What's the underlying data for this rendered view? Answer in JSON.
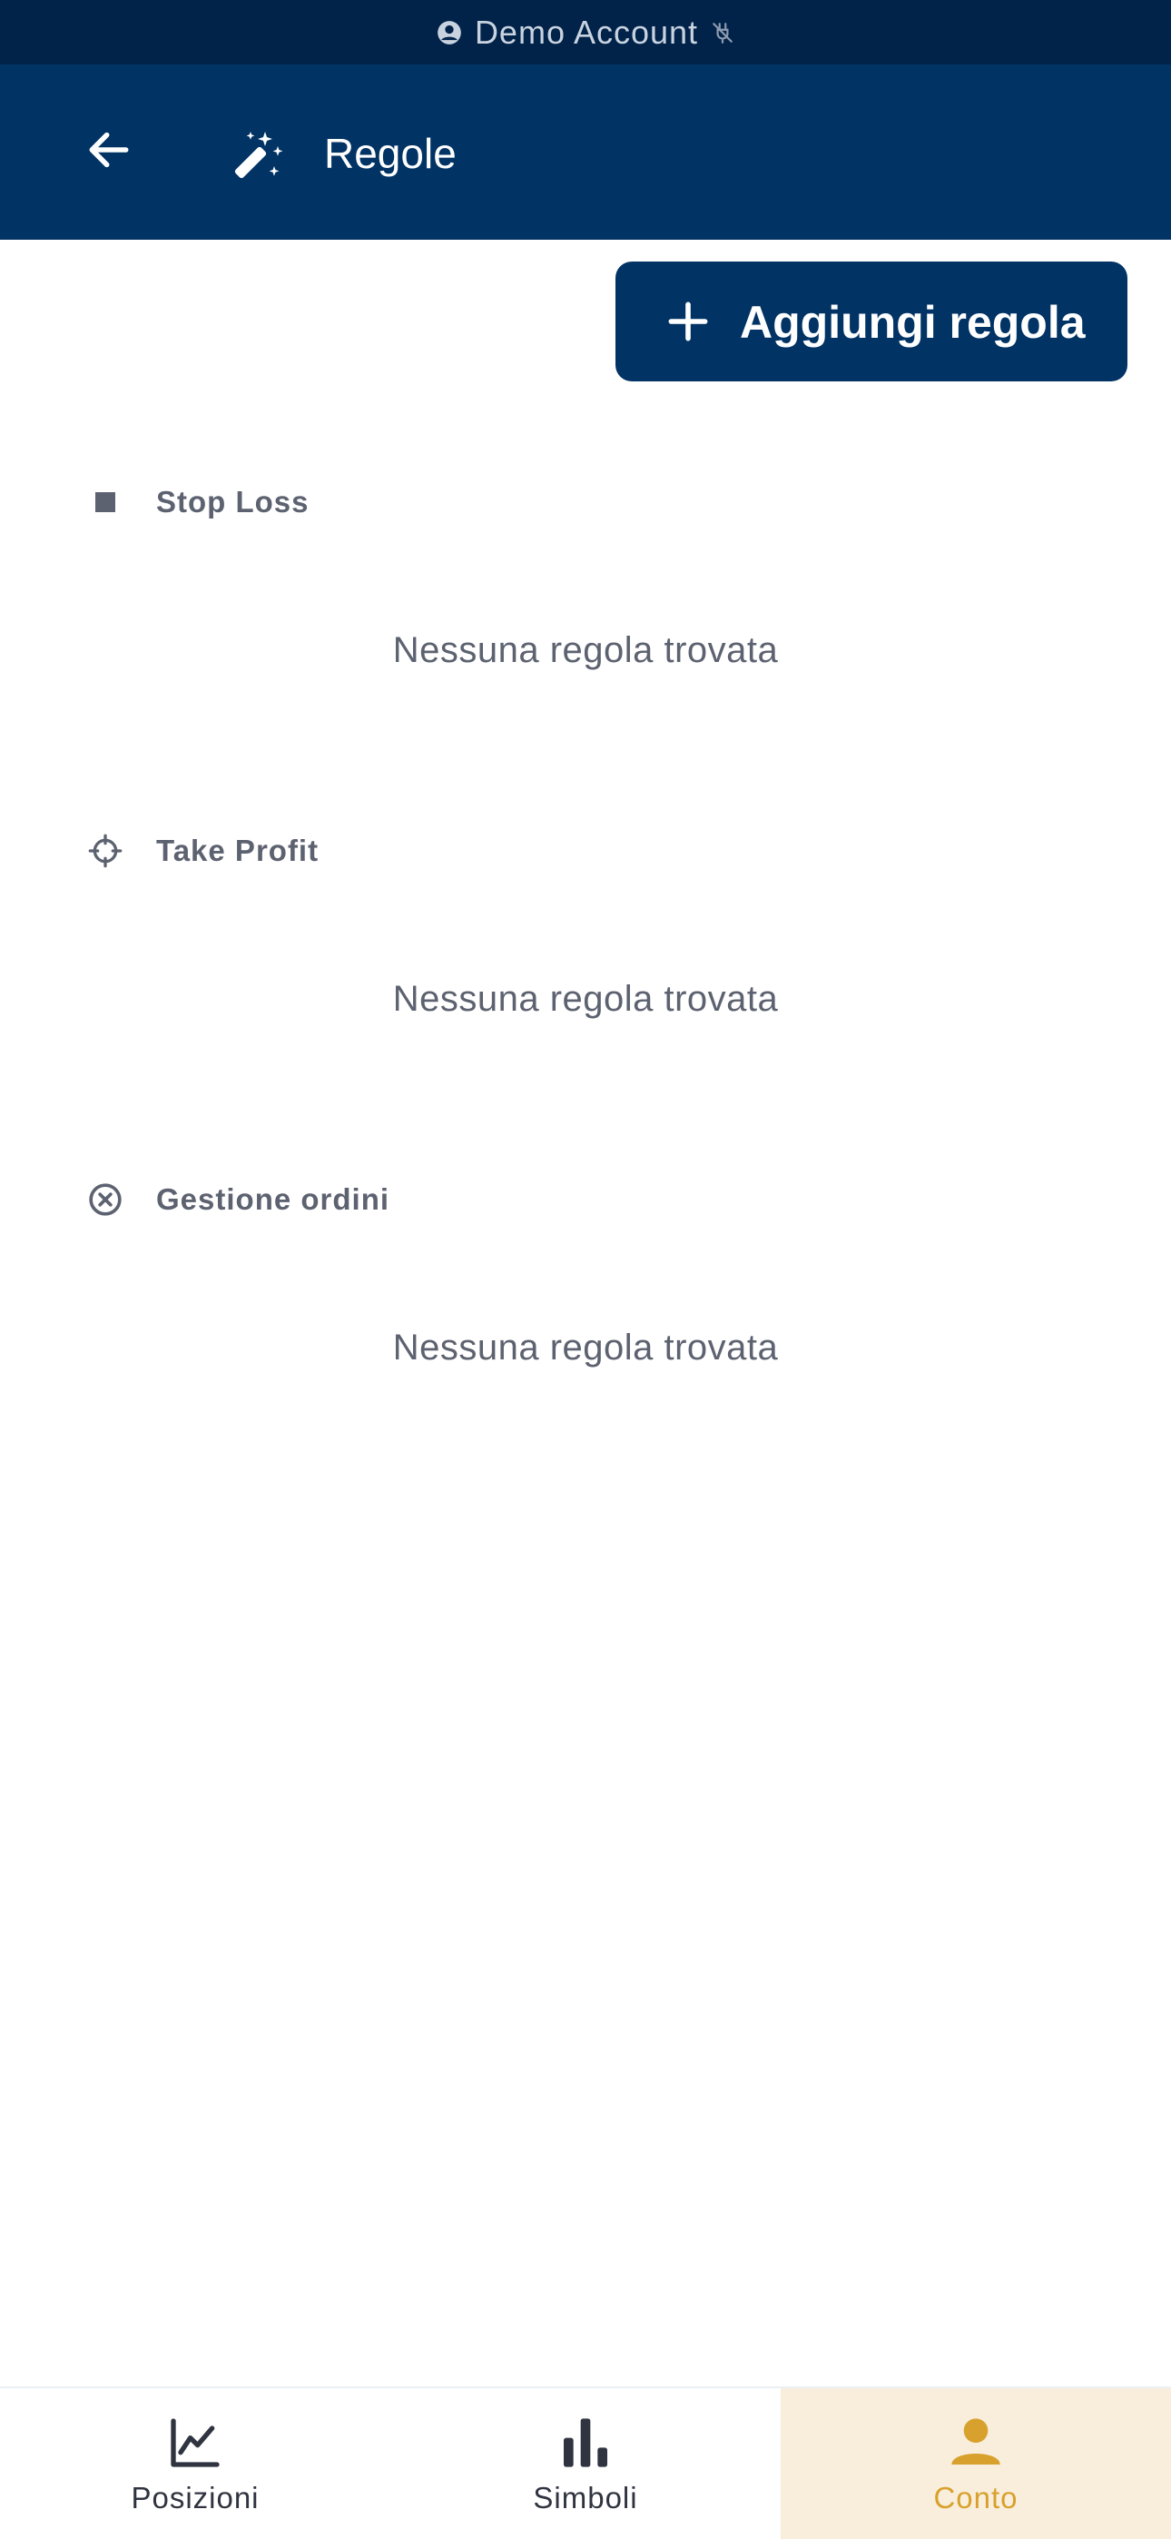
{
  "status_bar": {
    "account_label": "Demo Account",
    "icons": [
      "user-circle-icon",
      "signal-off-icon"
    ]
  },
  "header": {
    "title": "Regole",
    "back_icon": "arrow-left-icon",
    "title_icon": "magic-wand-icon"
  },
  "actions": {
    "add_rule_label": "Aggiungi regola",
    "add_icon": "plus-icon"
  },
  "sections": [
    {
      "title": "Stop Loss",
      "icon": "stop-square-icon",
      "empty_text": "Nessuna regola trovata"
    },
    {
      "title": "Take Profit",
      "icon": "crosshair-icon",
      "empty_text": "Nessuna regola trovata"
    },
    {
      "title": "Gestione ordini",
      "icon": "close-circle-icon",
      "empty_text": "Nessuna regola trovata"
    }
  ],
  "bottom_nav": {
    "items": [
      {
        "label": "Posizioni",
        "icon": "line-chart-icon",
        "active": false
      },
      {
        "label": "Simboli",
        "icon": "bar-chart-icon",
        "active": false
      },
      {
        "label": "Conto",
        "icon": "person-icon",
        "active": true
      }
    ]
  },
  "colors": {
    "status_strip": "#012349",
    "header": "#013365",
    "accent_active": "#d8a12d",
    "active_tab_bg": "#f8eedb",
    "muted_text": "#5d6270"
  }
}
